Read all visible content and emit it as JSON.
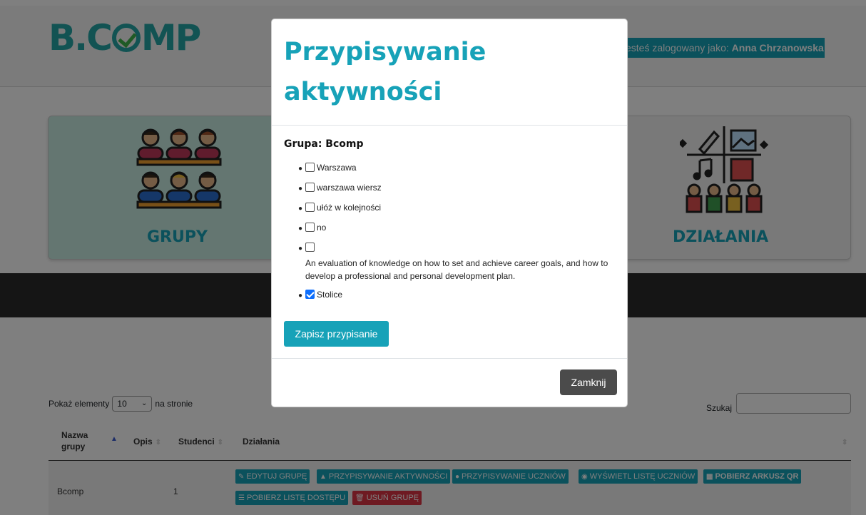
{
  "header": {
    "logo_text_left": "B.C",
    "logo_text_right": "MP",
    "login_prefix": "Jesteś zalogowany jako:",
    "login_user": "Anna Chrzanowska"
  },
  "tiles": {
    "groups_label": "GRUPY",
    "actions_label": "DZIAŁANIA"
  },
  "table": {
    "show_prefix": "Pokaż elementy",
    "page_size": "10",
    "show_suffix": "na stronie",
    "search_label": "Szukaj",
    "headers": [
      "Nazwa grupy",
      "Opis",
      "Studenci",
      "Działania"
    ],
    "rows": [
      {
        "name": "Bcomp",
        "description": "",
        "students": "1",
        "actions": [
          "EDYTUJ GRUPĘ",
          "PRZYPISYWANIE AKTYWNOŚCI",
          "PRZYPISYWANIE UCZNIÓW",
          "WYŚWIETL LISTĘ UCZNIÓW",
          "POBIERZ ARKUSZ QR",
          "POBIERZ LISTĘ DOSTĘPU",
          "USUŃ GRUPĘ"
        ]
      }
    ]
  },
  "modal": {
    "title": "Przypisywanie aktywności",
    "group_title": "Grupa: Bcomp",
    "activities": [
      {
        "label": "Warszawa",
        "checked": false
      },
      {
        "label": "warszawa wiersz",
        "checked": false
      },
      {
        "label": "ułóż w kolejności",
        "checked": false
      },
      {
        "label": "no",
        "checked": false
      },
      {
        "label": "",
        "description": "An evaluation of knowledge on how to set and achieve career goals, and how to develop a professional and personal development plan.",
        "checked": false
      },
      {
        "label": "Stolice",
        "checked": true
      }
    ],
    "save_label": "Zapisz przypisanie",
    "close_label": "Zamknij"
  },
  "colors": {
    "accent": "#17a2b8",
    "danger": "#dc3545",
    "logo": "#25a6a6",
    "logo_check": "#3fb44a"
  }
}
